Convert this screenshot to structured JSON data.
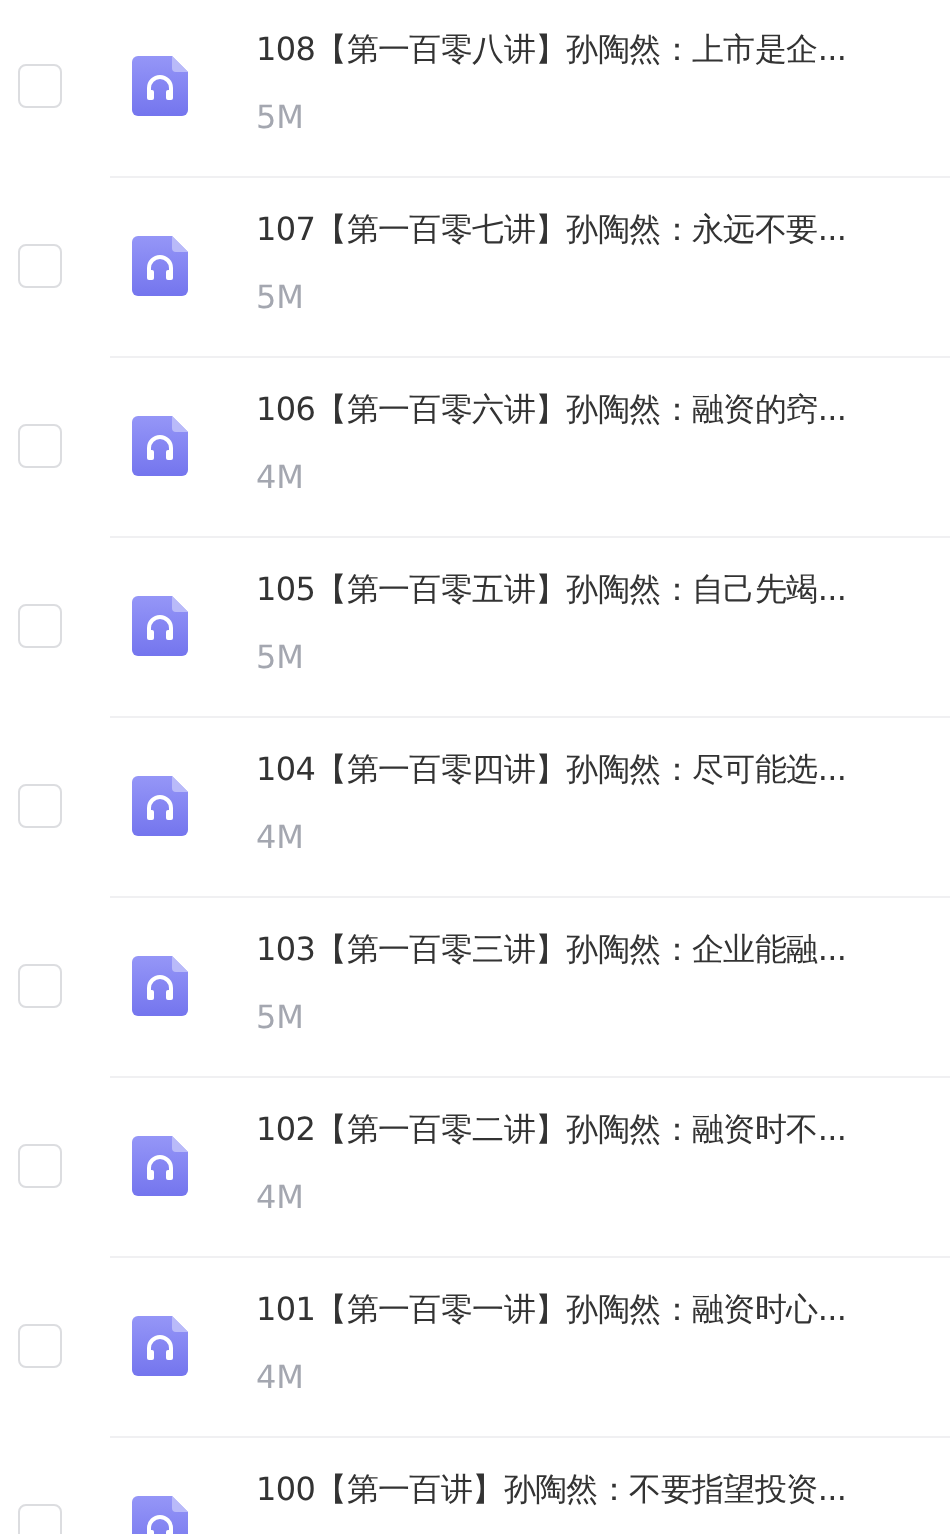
{
  "files": [
    {
      "title": "108【第一百零八讲】孙陶然：上市是企...",
      "size": "5M",
      "checked": false
    },
    {
      "title": "107【第一百零七讲】孙陶然：永远不要...",
      "size": "5M",
      "checked": false
    },
    {
      "title": "106【第一百零六讲】孙陶然：融资的窍...",
      "size": "4M",
      "checked": false
    },
    {
      "title": "105【第一百零五讲】孙陶然：自己先竭...",
      "size": "5M",
      "checked": false
    },
    {
      "title": "104【第一百零四讲】孙陶然：尽可能选...",
      "size": "4M",
      "checked": false
    },
    {
      "title": "103【第一百零三讲】孙陶然：企业能融...",
      "size": "5M",
      "checked": false
    },
    {
      "title": "102【第一百零二讲】孙陶然：融资时不...",
      "size": "4M",
      "checked": false
    },
    {
      "title": "101【第一百零一讲】孙陶然：融资时心...",
      "size": "4M",
      "checked": false
    },
    {
      "title": "100【第一百讲】孙陶然：不要指望投资...",
      "checked": false
    }
  ]
}
